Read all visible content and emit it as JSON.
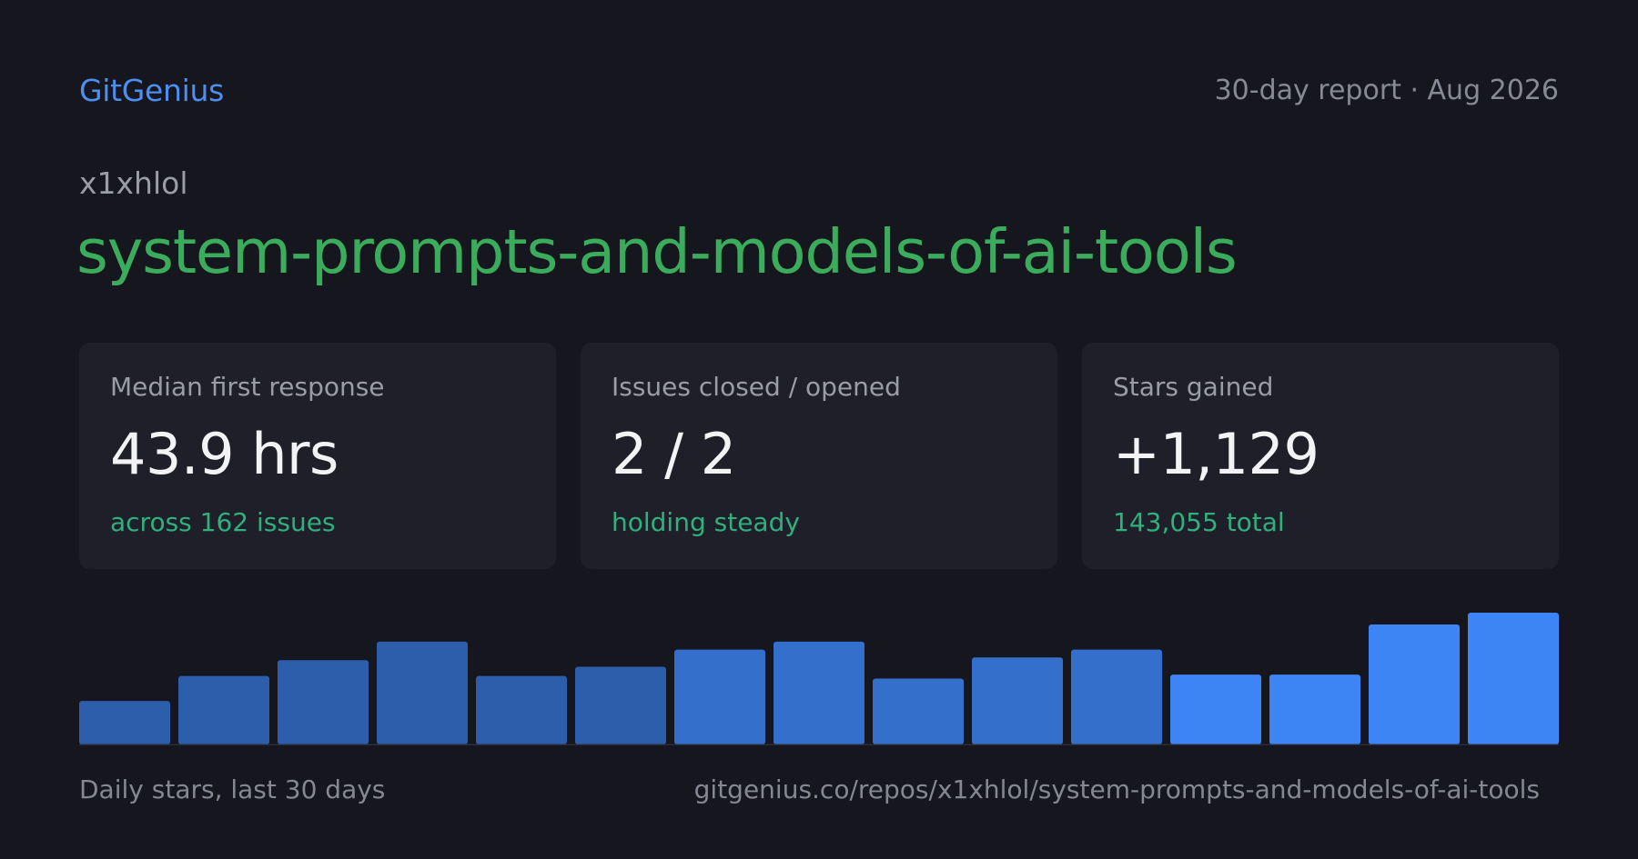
{
  "header": {
    "brand": "GitGenius",
    "report_label": "30-day report · Aug 2026"
  },
  "repo": {
    "owner": "x1xhlol",
    "name": "system-prompts-and-models-of-ai-tools"
  },
  "cards": [
    {
      "label": "Median first response",
      "value": "43.9 hrs",
      "note": "across 162 issues"
    },
    {
      "label": "Issues closed / opened",
      "value": "2 / 2",
      "note": "holding steady"
    },
    {
      "label": "Stars gained",
      "value": "+1,129",
      "note": "143,055 total"
    }
  ],
  "colors": {
    "background": "#15161e",
    "brand": "#4d8ff0",
    "repo_name": "#3bac5c",
    "card_background": "#1e1f29",
    "note": "#2fb07d",
    "bar_dark": "#2d5eab",
    "bar_light": "#3d84f5"
  },
  "chart_data": {
    "type": "bar",
    "title": "",
    "xlabel": "",
    "ylabel": "",
    "caption": "Daily stars, last 30 days",
    "grid": false,
    "legend": "none",
    "values": [
      0.33,
      0.52,
      0.64,
      0.78,
      0.52,
      0.59,
      0.72,
      0.78,
      0.5,
      0.66,
      0.72,
      0.53,
      0.53,
      0.91,
      1.0
    ],
    "ylim": [
      0,
      1
    ]
  },
  "footer": {
    "caption": "Daily stars, last 30 days",
    "url": "gitgenius.co/repos/x1xhlol/system-prompts-and-models-of-ai-tools"
  }
}
